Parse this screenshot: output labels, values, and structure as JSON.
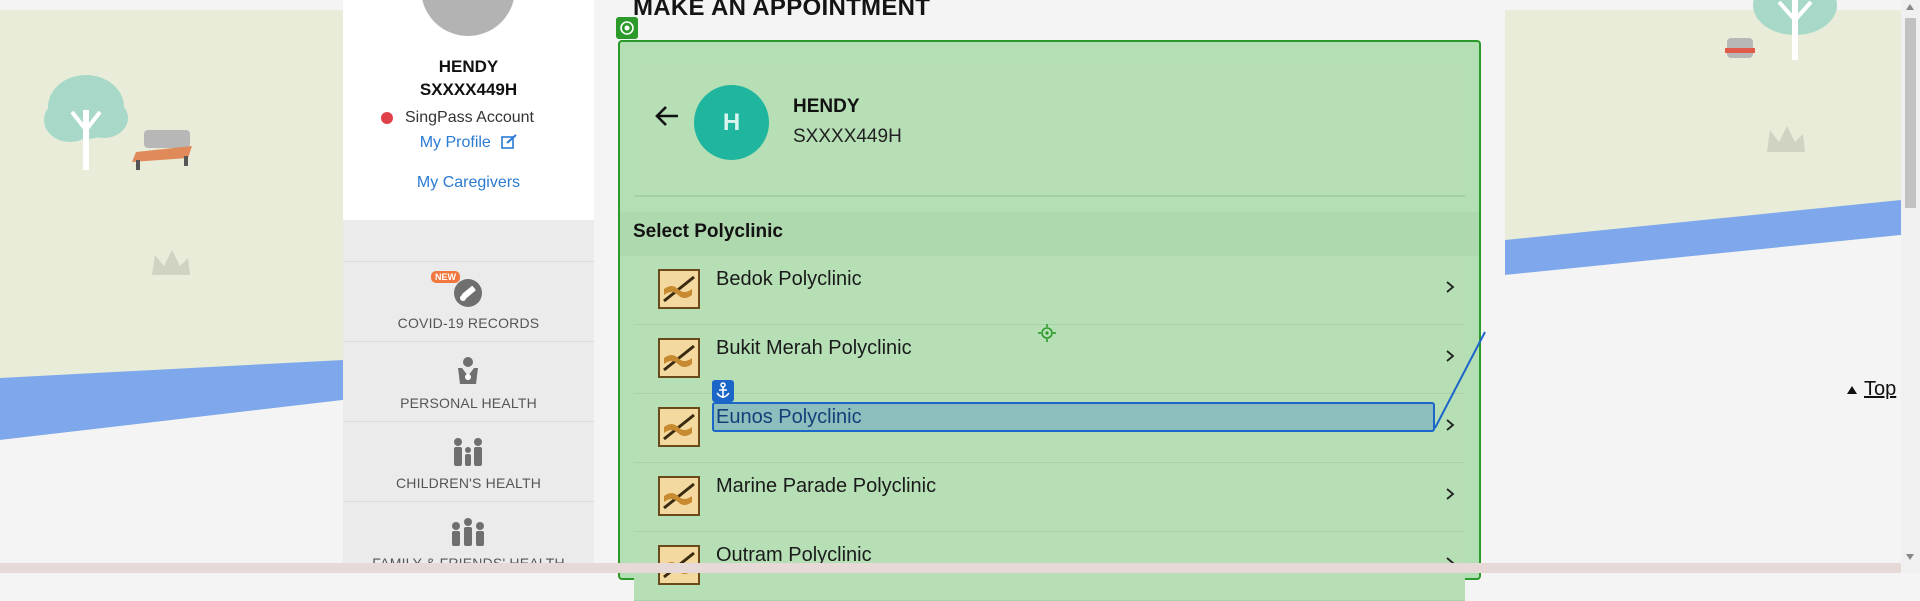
{
  "page": {
    "title": "MAKE AN APPOINTMENT",
    "top_link": "Top"
  },
  "profile": {
    "name": "HENDY",
    "id": "SXXXX449H",
    "account": "SingPass Account",
    "my_profile": "My Profile",
    "my_caregivers": "My Caregivers"
  },
  "menu": {
    "items": [
      {
        "label": "COVID-19 RECORDS",
        "badge": "NEW",
        "icon": "syringe-icon"
      },
      {
        "label": "PERSONAL HEALTH",
        "icon": "person-icon"
      },
      {
        "label": "CHILDREN'S HEALTH",
        "icon": "family-icon"
      },
      {
        "label": "FAMILY & FRIENDS' HEALTH",
        "icon": "group-icon"
      }
    ]
  },
  "patient": {
    "initial": "H",
    "name": "HENDY",
    "id": "SXXXX449H"
  },
  "polyclinics": {
    "heading": "Select Polyclinic",
    "items": [
      {
        "name": "Bedok Polyclinic"
      },
      {
        "name": "Bukit Merah Polyclinic"
      },
      {
        "name": "Eunos Polyclinic"
      },
      {
        "name": "Marine Parade Polyclinic"
      },
      {
        "name": "Outram Polyclinic"
      }
    ]
  },
  "colors": {
    "accent_green": "#2b9a2b",
    "highlight_blue": "#1c65c9",
    "avatar_teal": "#1fb59e",
    "link_blue": "#2b7bd3"
  }
}
